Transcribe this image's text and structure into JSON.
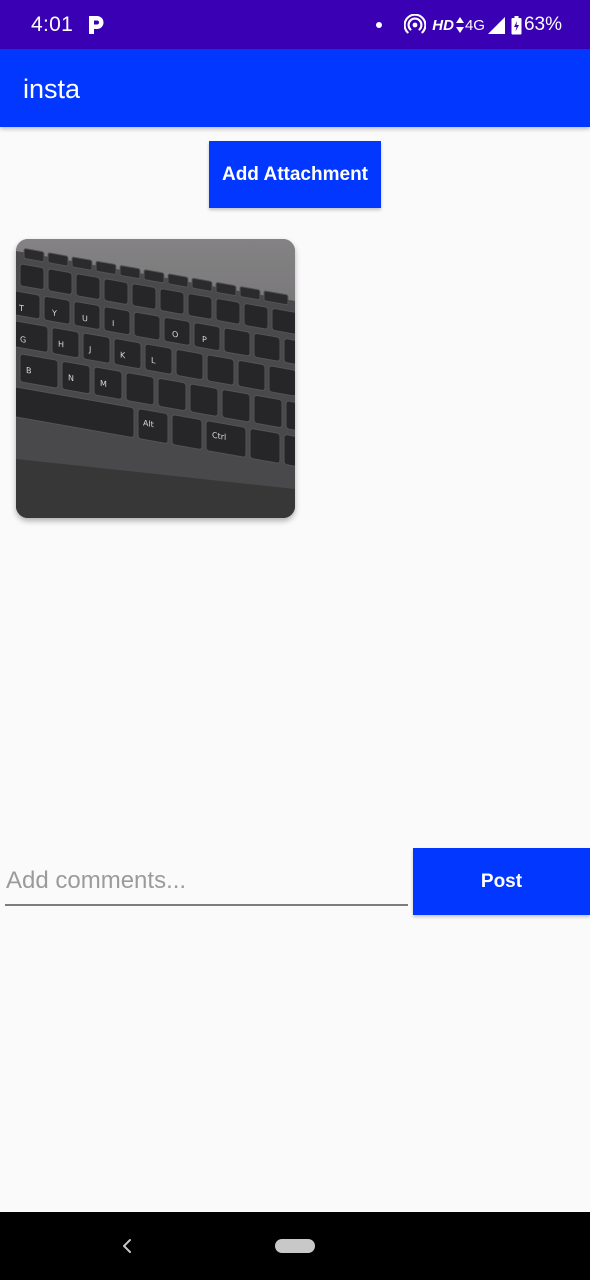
{
  "status_bar": {
    "time": "4:01",
    "network_label": "HD",
    "network_type": "4G",
    "battery": "63%",
    "icons": [
      "p-app-icon",
      "dot-icon",
      "hotspot-icon",
      "data-arrows-icon",
      "signal-icon",
      "battery-icon"
    ]
  },
  "app_bar": {
    "title": "insta"
  },
  "attachment": {
    "button_label": "Add Attachment",
    "image_description": "keyboard-photo"
  },
  "comment": {
    "placeholder": "Add comments...",
    "value": ""
  },
  "post": {
    "button_label": "Post"
  },
  "nav_bar": {
    "icons": [
      "back-icon",
      "home-pill-icon"
    ]
  },
  "colors": {
    "status_bar": "#3a00b4",
    "primary": "#0137ff",
    "background": "#fafafa",
    "on_primary": "#ffffff"
  }
}
